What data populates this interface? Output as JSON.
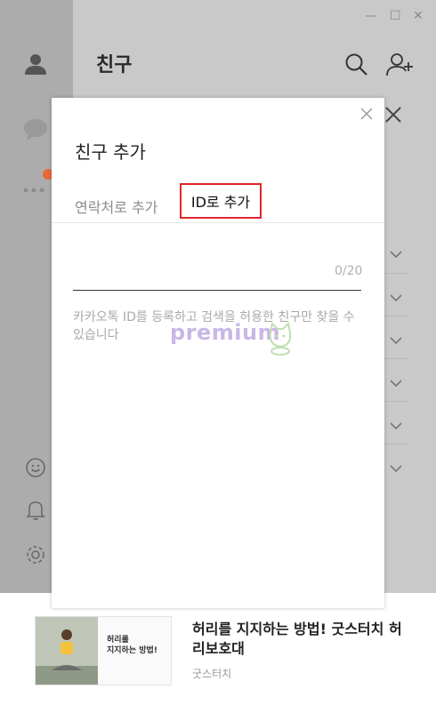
{
  "header": {
    "title": "친구"
  },
  "window_controls": {
    "minimize": "—",
    "maximize": "☐",
    "close": "✕"
  },
  "sidebar": {
    "badge_color": "#e8693a",
    "icons": [
      "person-icon",
      "chat-icon",
      "more-icon",
      "emoji-icon",
      "bell-icon",
      "gear-icon"
    ]
  },
  "dialog": {
    "title": "친구 추가",
    "tabs": [
      {
        "label": "연락처로 추가",
        "active": false
      },
      {
        "label": "ID로 추가",
        "active": true
      }
    ],
    "input": {
      "counter": "0/20"
    },
    "help_text": "카카오톡 ID를 등록하고 검색을 허용한 친구만 찾을 수 있습니다",
    "highlight_color": "#e0262c"
  },
  "watermark": {
    "text": "premium"
  },
  "ad": {
    "title": "허리를 지지하는 방법! 굿스터치 허리보호대",
    "brand": "굿스터치",
    "image_caption_line1": "허리를",
    "image_caption_line2": "지지하는 방법!"
  }
}
